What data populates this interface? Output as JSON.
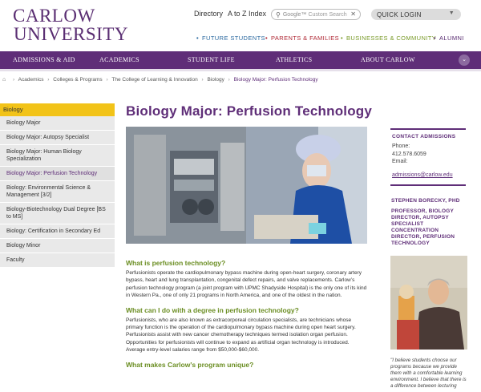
{
  "logo": {
    "line1": "CARLOW",
    "line2": "UNIVERSITY"
  },
  "utility": {
    "directory": "Directory",
    "az": "A to Z Index"
  },
  "search": {
    "brand": "Google™",
    "placeholder": "Custom Search",
    "clear": "✕"
  },
  "quick_login": {
    "label": "QUICK LOGIN",
    "icon": "chevron-down-icon"
  },
  "audience_nav": [
    {
      "label": "FUTURE STUDENTS",
      "color": "#2c6aa0"
    },
    {
      "label": "PARENTS & FAMILIES",
      "color": "#b02a36"
    },
    {
      "label": "BUSINESSES & COMMUNITY",
      "color": "#7a9b2a"
    },
    {
      "label": "ALUMNI",
      "color": "#5a2e72"
    }
  ],
  "main_nav": [
    {
      "label": "ADMISSIONS & AID"
    },
    {
      "label": "ACADEMICS"
    },
    {
      "label": "STUDENT LIFE"
    },
    {
      "label": "ATHLETICS"
    },
    {
      "label": "ABOUT CARLOW"
    }
  ],
  "breadcrumb": {
    "items": [
      "Academics",
      "Colleges & Programs",
      "The College of Learning & Innovation",
      "Biology"
    ],
    "current": "Biology Major: Perfusion Technology"
  },
  "sidebar": {
    "heading": "Biology",
    "items": [
      {
        "label": "Biology Major",
        "active": false
      },
      {
        "label": "Biology Major: Autopsy Specialist",
        "active": false
      },
      {
        "label": "Biology Major: Human Biology Specialization",
        "active": false
      },
      {
        "label": "Biology Major: Perfusion Technology",
        "active": true
      },
      {
        "label": "Biology: Environmental Science & Management [3/2]",
        "active": false
      },
      {
        "label": "Biology-Biotechnology Dual Degree [BS to MS]",
        "active": false
      },
      {
        "label": "Biology: Certification in Secondary Ed",
        "active": false
      },
      {
        "label": "Biology Minor",
        "active": false
      },
      {
        "label": "Faculty",
        "active": false
      }
    ]
  },
  "page": {
    "title": "Biology Major: Perfusion Technology",
    "sections": [
      {
        "heading": "What is perfusion technology?",
        "body": "Perfusionists operate the cardiopulmonary bypass machine during open-heart surgery, coronary artery bypass, heart and lung transplantation, congenital defect repairs, and valve replacements. Carlow’s perfusion technology program (a joint program with UPMC Shadyside Hospital) is the only one of its kind in Western Pa., one of only 21 programs in North America, and one of the oldest in the nation."
      },
      {
        "heading": "What can I do with a degree in perfusion technology?",
        "body": "Perfusionists, who are also known as extracorporeal circulation specialists, are technicians whose primary function is the operation of the cardiopulmonary bypass machine during open heart surgery. Perfusionists assist with new cancer chemotherapy techniques termed isolation organ perfusion. Opportunities for perfusionists will continue to expand as artificial organ technology is introduced. Average entry-level salaries range from $50,000-$60,000."
      },
      {
        "heading": "What makes Carlow’s program unique?",
        "body": ""
      }
    ]
  },
  "contact": {
    "heading": "CONTACT ADMISSIONS",
    "phone_label": "Phone:",
    "phone": "412.578.6059",
    "email_label": "Email:",
    "email": "admissions@carlow.edu"
  },
  "faculty": {
    "name": "STEPHEN BORECKY, PHD",
    "title": "PROFESSOR, BIOLOGY DIRECTOR, AUTOPSY SPECIALIST CONCENTRATION DIRECTOR, PERFUSION TECHNOLOGY",
    "quote": "\"I believe students choose our programs because we provide them with a comfortable learning environment. I believe that there is a difference between lecturing"
  },
  "colors": {
    "brand_purple": "#5f2e78",
    "gold": "#f2c318",
    "green_heading": "#6b8e23"
  }
}
